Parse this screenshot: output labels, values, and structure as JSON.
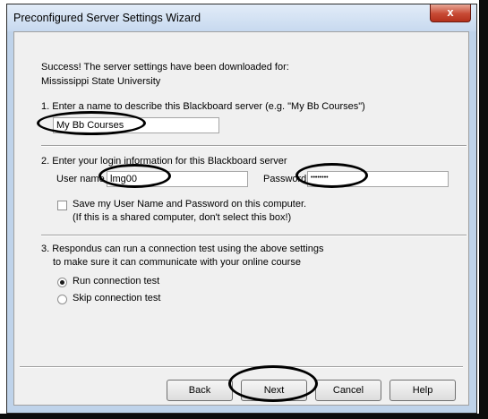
{
  "window": {
    "title": "Preconfigured Server Settings Wizard",
    "close_glyph": "x"
  },
  "success": {
    "line1": "Success! The server settings have been downloaded for:",
    "line2": "Mississippi State University"
  },
  "step1": {
    "label": "1.  Enter a name to describe this Blackboard server (e.g. \"My Bb Courses\")",
    "value": "My Bb Courses"
  },
  "step2": {
    "label": "2.  Enter your login information for this Blackboard server",
    "username_label": "User name",
    "username_value": "lmg00",
    "password_label": "Password",
    "password_value": "••••••••",
    "save_line1": "Save my User Name and Password on this computer.",
    "save_line2": "(If this is a shared computer, don't select this box!)",
    "save_checked": false
  },
  "step3": {
    "line1": "3.  Respondus can run a connection test using the above settings",
    "line2": "to make sure it can communicate with your online course",
    "options": [
      {
        "label": "Run connection test",
        "selected": true
      },
      {
        "label": "Skip connection test",
        "selected": false
      }
    ]
  },
  "buttons": {
    "back": "Back",
    "next": "Next",
    "cancel": "Cancel",
    "help": "Help"
  }
}
